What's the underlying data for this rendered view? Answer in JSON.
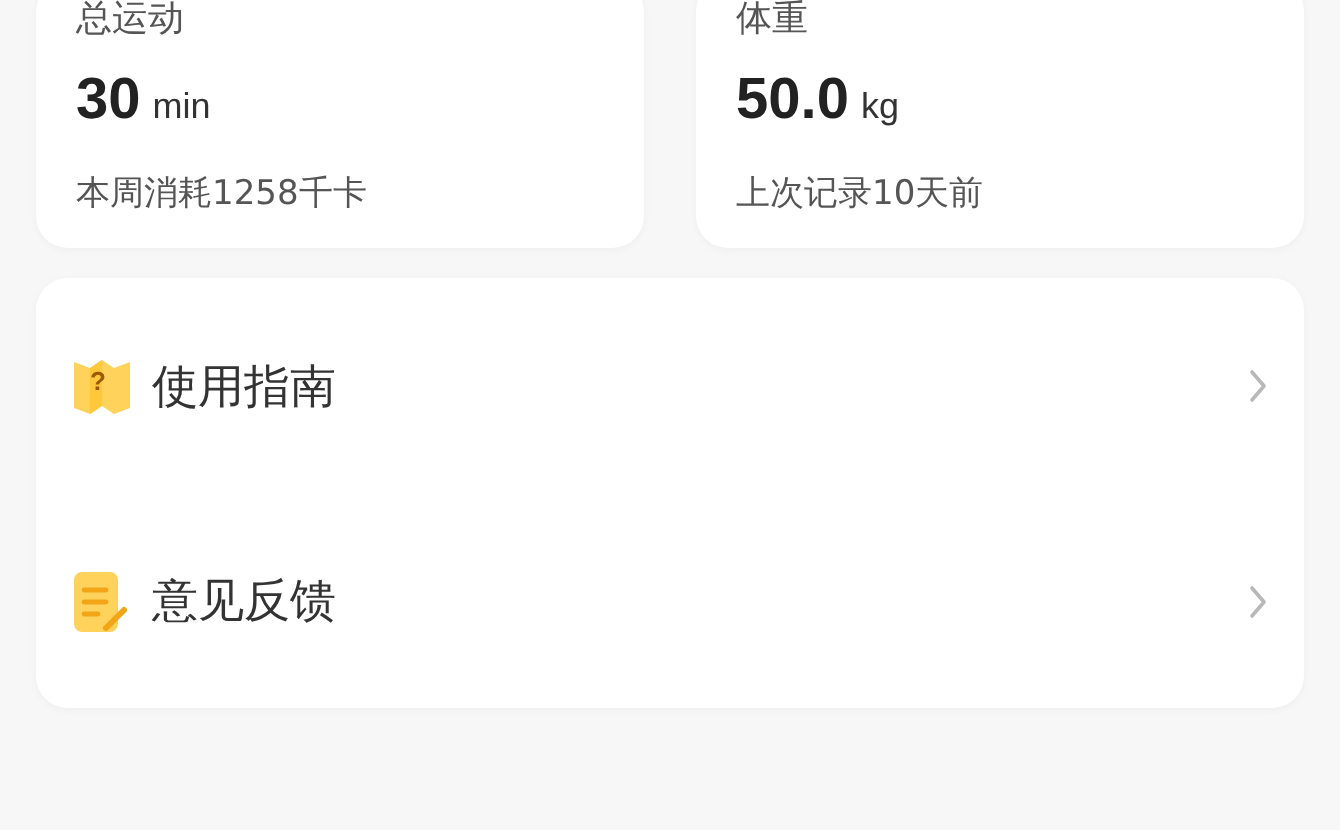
{
  "stats": [
    {
      "title": "总运动",
      "value": "30",
      "unit": "min",
      "note": "本周消耗1258千卡"
    },
    {
      "title": "体重",
      "value": "50.0",
      "unit": "kg",
      "note": "上次记录10天前"
    }
  ],
  "menu": [
    {
      "kind": "guide",
      "icon_mark": "?",
      "label": "使用指南"
    },
    {
      "kind": "feedback",
      "label": "意见反馈"
    }
  ]
}
